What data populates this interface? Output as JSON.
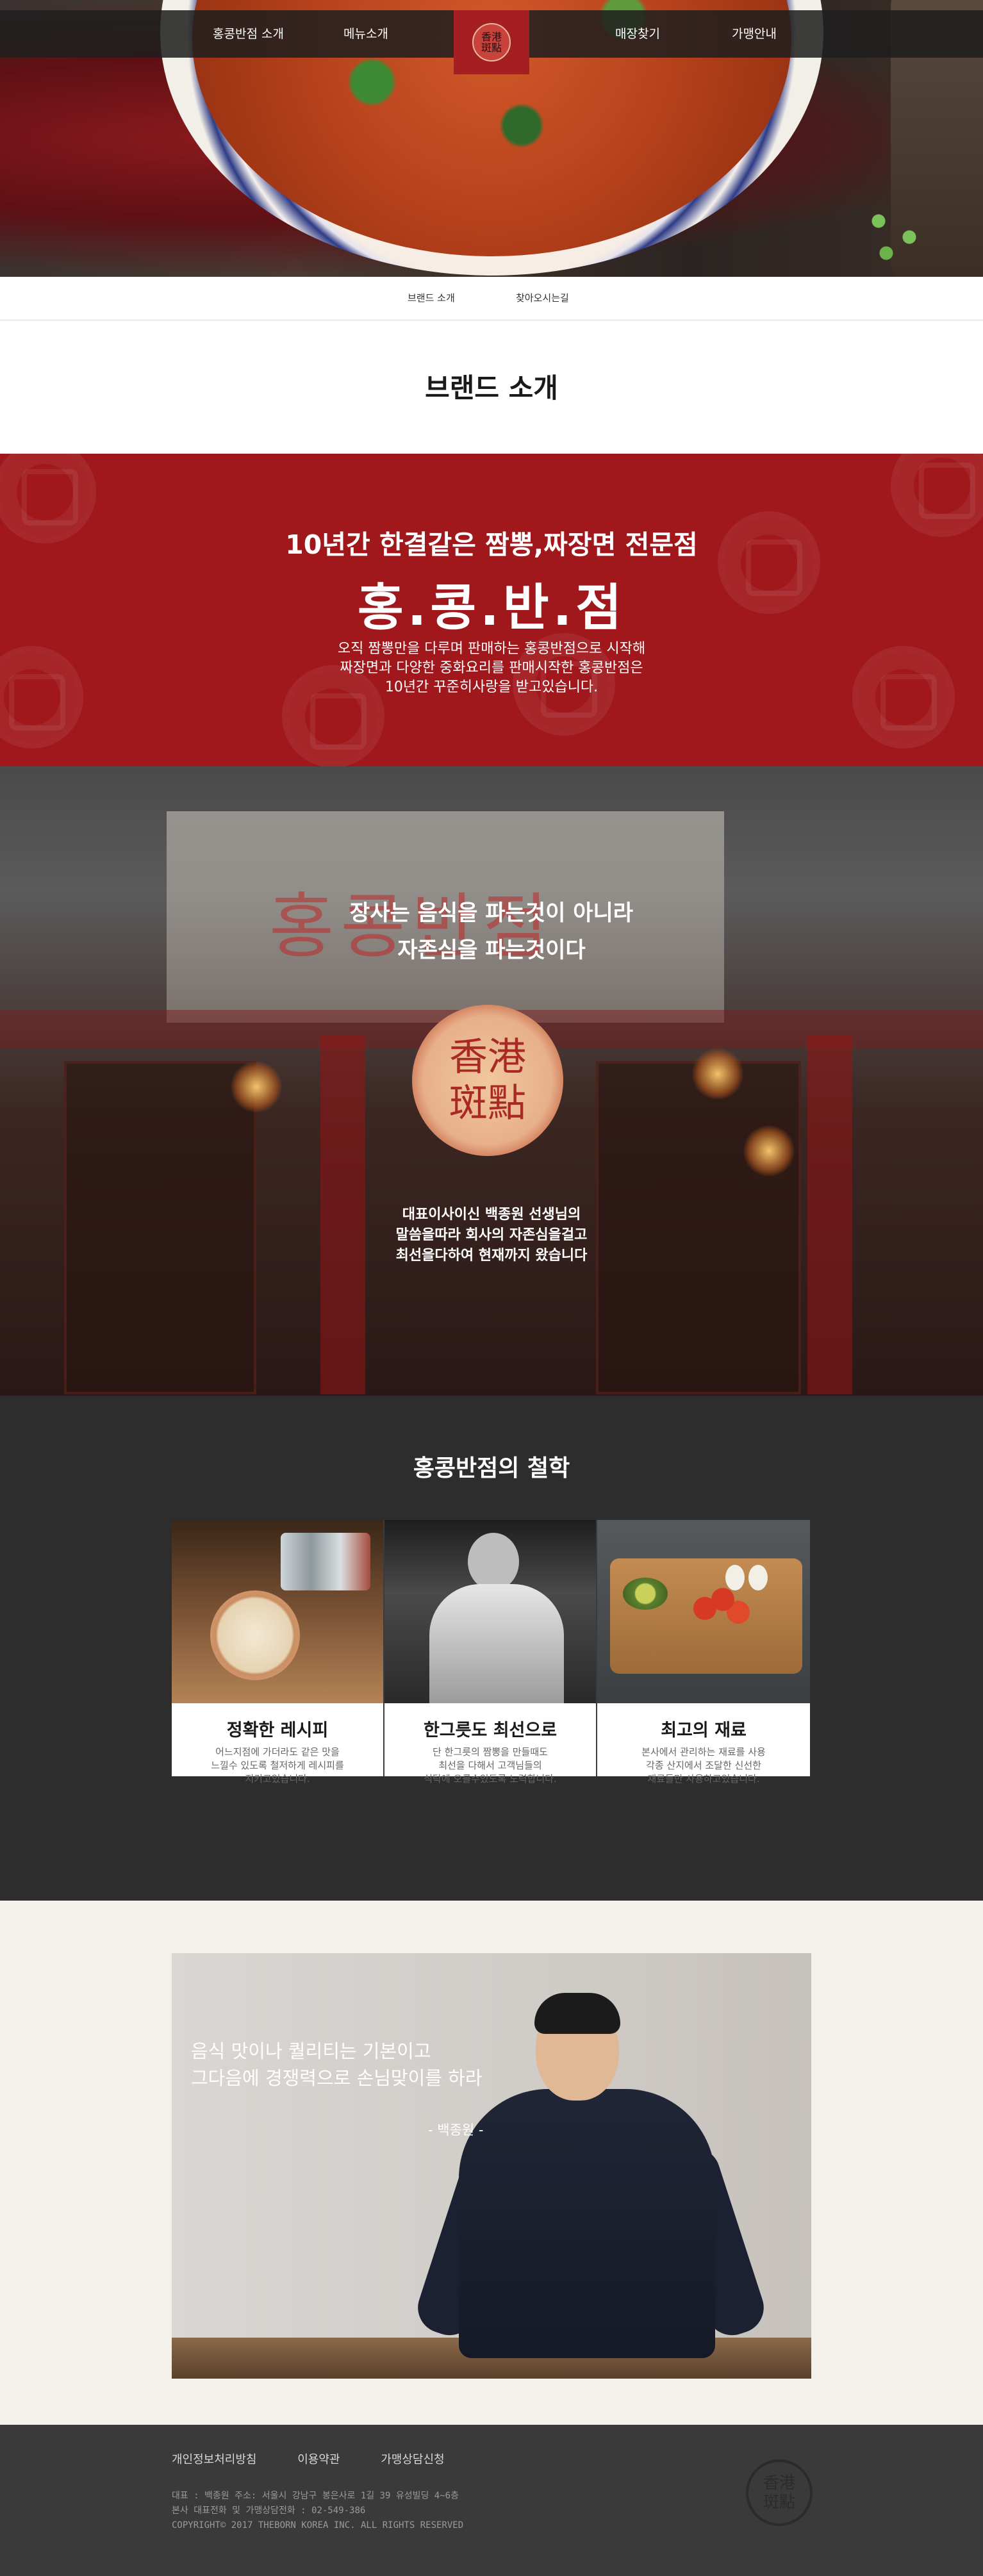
{
  "nav": {
    "items": [
      "홍콩반점 소개",
      "메뉴소개",
      "매장찾기",
      "가맹안내"
    ],
    "logo": "香港\n斑點"
  },
  "subnav": {
    "items": [
      "브랜드 소개",
      "찾아오시는길"
    ]
  },
  "page_title": "브랜드 소개",
  "intro": {
    "subtitle": "10년간 한결같은 짬뽕,짜장면 전문점",
    "brand": "홍.콩.반.점",
    "description": [
      "오직 짬뽕만을 다루며 판매하는 홍콩반점으로 시작해",
      "짜장면과 다양한 중화요리를 판매시작한 홍콩반점은",
      "10년간 꾸준히사랑을 받고있습니다."
    ]
  },
  "store": {
    "heading": [
      "장사는 음식을 파는것이 아니라",
      "자존심을 파는것이다"
    ],
    "seal": "香港\n斑點",
    "footer": [
      "대표이사이신 백종원 선생님의",
      "말씀을따라 회사의 자존심을걸고",
      "최선을다하여 현재까지 왔습니다"
    ]
  },
  "philosophy": {
    "title": "홍콩반점의  철학",
    "cards": [
      {
        "title": "정확한 레시피",
        "desc": [
          "어느지점에 가더라도 같은 맛을",
          "느낄수 있도록 철저하게 레시피를",
          "지키고있습니다."
        ]
      },
      {
        "title": "한그릇도 최선으로",
        "desc": [
          "단 한그릇의 짬뽕을 만들때도",
          "최선을 다해서 고객님들의",
          "식탁에 오를수있도록 노력합니다."
        ]
      },
      {
        "title": "최고의 재료",
        "desc": [
          "본사에서 관리하는 재료를 사용",
          "각종 산지에서 조달한 신선한",
          "재료들만 사용하고있습니다."
        ]
      }
    ]
  },
  "quote": {
    "lines": [
      "음식 맛이나 퀄리티는 기본이고",
      "그다음에 경쟁력으로 손님맞이를 하라"
    ],
    "author": "- 백종원 -"
  },
  "footer": {
    "links": [
      "개인정보처리방침",
      "이용약관",
      "가맹상담신청"
    ],
    "info": [
      "대표 : 백종원  주소: 서울시 강남구 봉은사로 1길 39 유성빌딩 4~6층",
      "본사 대표전화 및 가맹상담전화 : 02-549-386",
      "COPYRIGHT© 2017 THEBORN KOREA INC. ALL RIGHTS RESERVED"
    ],
    "seal": "香港\n斑點"
  },
  "colors": {
    "brand_red": "#a0181c",
    "dark": "#2d2d2d",
    "footer": "#3a3a3a",
    "cream": "#f4f1ea"
  }
}
